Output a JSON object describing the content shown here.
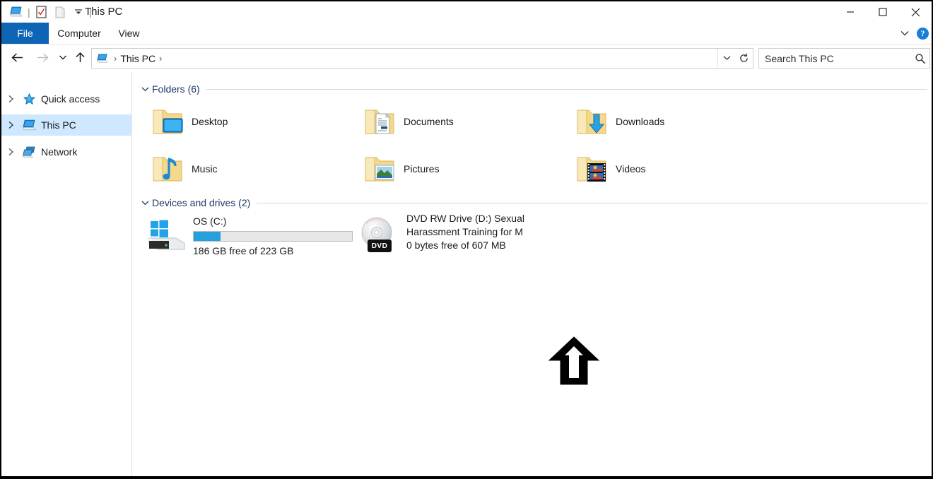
{
  "window": {
    "title": "This PC",
    "quick_access_toolbar": [
      {
        "name": "this-pc-icon",
        "label": "This PC"
      },
      {
        "name": "properties-icon",
        "label": "Properties"
      },
      {
        "name": "new-folder-icon",
        "label": "New folder"
      },
      {
        "name": "customize-chevron-icon",
        "label": "Customize Quick Access Toolbar"
      }
    ],
    "controls": {
      "minimize": "Minimize",
      "maximize": "Maximize",
      "close": "Close"
    }
  },
  "ribbon": {
    "tabs": [
      {
        "label": "File"
      },
      {
        "label": "Computer"
      },
      {
        "label": "View"
      }
    ],
    "collapse_label": "Minimize the Ribbon",
    "help_label": "?"
  },
  "navbar": {
    "back": "Back",
    "forward": "Forward",
    "recent": "Recent locations",
    "up": "Up",
    "address": {
      "root_icon": "this-pc-icon",
      "crumb": "This PC",
      "sep1": "›",
      "sep2": "›"
    },
    "refresh": "Refresh",
    "search": {
      "placeholder": "Search This PC",
      "value": "Search This PC"
    }
  },
  "sidebar": {
    "items": [
      {
        "label": "Quick access",
        "icon": "star-icon",
        "selected": false
      },
      {
        "label": "This PC",
        "icon": "this-pc-icon",
        "selected": true
      },
      {
        "label": "Network",
        "icon": "network-icon",
        "selected": false
      }
    ]
  },
  "main": {
    "groups": [
      {
        "title": "Folders (6)",
        "items": [
          {
            "label": "Desktop",
            "icon": "folder-desktop-icon"
          },
          {
            "label": "Documents",
            "icon": "folder-documents-icon"
          },
          {
            "label": "Downloads",
            "icon": "folder-downloads-icon"
          },
          {
            "label": "Music",
            "icon": "folder-music-icon"
          },
          {
            "label": "Pictures",
            "icon": "folder-pictures-icon"
          },
          {
            "label": "Videos",
            "icon": "folder-videos-icon"
          }
        ]
      },
      {
        "title": "Devices and drives (2)",
        "drives": [
          {
            "name": "OS (C:)",
            "icon": "hard-drive-icon",
            "free_text": "186 GB free of 223 GB",
            "used_percent": 17,
            "has_bar": true
          },
          {
            "name_line1": "DVD RW Drive (D:) Sexual",
            "name_line2": "Harassment Training for M",
            "icon": "dvd-drive-icon",
            "badge": "DVD",
            "free_text": "0 bytes free of 607 MB",
            "has_bar": false
          }
        ]
      }
    ]
  },
  "annotation": {
    "arrow": "up-arrow-annotation"
  },
  "colors": {
    "accent": "#0E65B5",
    "selection": "#cde8ff",
    "bar_fill": "#26a0da",
    "group_title": "#1f3864"
  }
}
